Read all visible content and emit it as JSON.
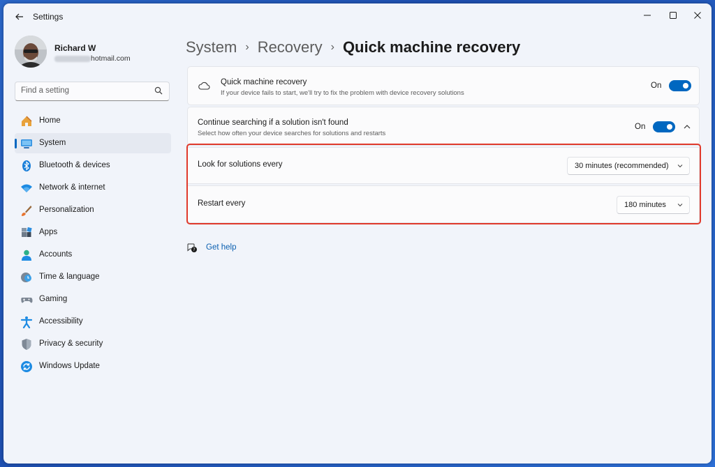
{
  "window": {
    "title": "Settings"
  },
  "profile": {
    "name": "Richard W",
    "email_suffix": "hotmail.com"
  },
  "search": {
    "placeholder": "Find a setting"
  },
  "sidebar": {
    "items": [
      {
        "label": "Home",
        "icon": "home-icon"
      },
      {
        "label": "System",
        "icon": "system-icon",
        "active": true
      },
      {
        "label": "Bluetooth & devices",
        "icon": "bluetooth-icon"
      },
      {
        "label": "Network & internet",
        "icon": "wifi-icon"
      },
      {
        "label": "Personalization",
        "icon": "brush-icon"
      },
      {
        "label": "Apps",
        "icon": "apps-icon"
      },
      {
        "label": "Accounts",
        "icon": "person-icon"
      },
      {
        "label": "Time & language",
        "icon": "clock-globe-icon"
      },
      {
        "label": "Gaming",
        "icon": "controller-icon"
      },
      {
        "label": "Accessibility",
        "icon": "accessibility-icon"
      },
      {
        "label": "Privacy & security",
        "icon": "shield-icon"
      },
      {
        "label": "Windows Update",
        "icon": "update-icon"
      }
    ]
  },
  "breadcrumb": [
    "System",
    "Recovery",
    "Quick machine recovery"
  ],
  "settings": {
    "qmr": {
      "title": "Quick machine recovery",
      "subtitle": "If your device fails to start, we'll try to fix the problem with device recovery solutions",
      "state": "On"
    },
    "continue": {
      "title": "Continue searching if a solution isn't found",
      "subtitle": "Select how often your device searches for solutions and restarts",
      "state": "On"
    },
    "look_every": {
      "label": "Look for solutions every",
      "value": "30 minutes (recommended)"
    },
    "restart_every": {
      "label": "Restart every",
      "value": "180 minutes"
    }
  },
  "help": {
    "label": "Get help"
  },
  "colors": {
    "accent": "#0067c0",
    "highlight": "#e0392b",
    "link": "#0a5fb0"
  }
}
